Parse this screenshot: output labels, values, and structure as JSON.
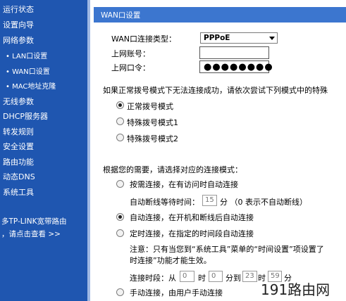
{
  "sidebar": {
    "items": [
      {
        "label": "运行状态"
      },
      {
        "label": "设置向导"
      },
      {
        "label": "网络参数"
      },
      {
        "label": "• LAN口设置"
      },
      {
        "label": "• WAN口设置"
      },
      {
        "label": "• MAC地址克隆"
      },
      {
        "label": "无线参数"
      },
      {
        "label": "DHCP服务器"
      },
      {
        "label": "转发规则"
      },
      {
        "label": "安全设置"
      },
      {
        "label": "路由功能"
      },
      {
        "label": "动态DNS"
      },
      {
        "label": "系统工具"
      }
    ],
    "promo_line1": "多TP-LINK宽带路由",
    "promo_line2": "，请点击查看 >>"
  },
  "panel": {
    "title": "WAN口设置",
    "conn_type_label": "WAN口连接类型：",
    "conn_type_value": "PPPoE",
    "account_label": "上网账号：",
    "account_value": "",
    "password_label": "上网口令：",
    "password_dots": "●●●●●●●●",
    "hint": "如果正常拨号模式下无法连接成功，请依次尝试下列模式中的特殊",
    "dial_modes": [
      "正常拨号模式",
      "特殊拨号模式1",
      "特殊拨号模式2"
    ],
    "selected_dial_mode": 0,
    "mode_hint": "根据您的需要，请选择对应的连接模式：",
    "on_demand_label": "按需连接，在有访问时自动连接",
    "idle_prefix": "自动断线等待时间：",
    "idle_value": "15",
    "idle_suffix": "分 （0 表示不自动断线）",
    "auto_label": "自动连接，在开机和断线后自动连接",
    "timed_label": "定时连接，在指定的时间段自动连接",
    "note_line1": "注意：只有当您到“系统工具”菜单的“时间设置”项设置了",
    "note_line2": "时连接”功能才能生效。",
    "period_prefix": "连接时段：从",
    "start_hour": "0",
    "hour_label": "时",
    "start_min": "0",
    "to_label": "分到",
    "end_hour": "23",
    "hour_label2": "时",
    "end_min": "59",
    "min_label": "分",
    "manual_label": "手动连接，由用户手动连接",
    "selected_conn_mode": 1
  },
  "watermark": "191路由网",
  "colors": {
    "sidebar_bg": "#1f56b0",
    "header_bg": "#3c76cf"
  }
}
